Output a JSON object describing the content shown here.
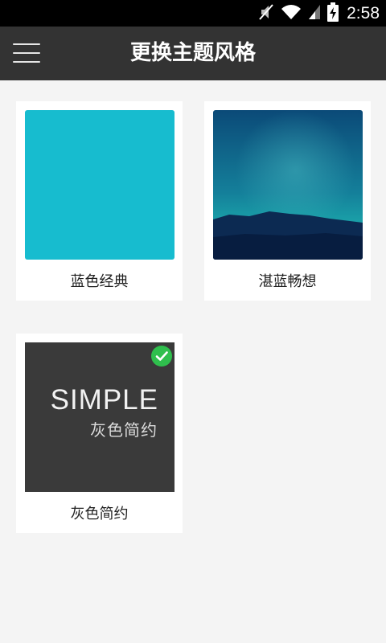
{
  "status_bar": {
    "time": "2:58",
    "icons": [
      "mute-icon",
      "wifi-icon",
      "signal-icon",
      "battery-charging-icon"
    ]
  },
  "app_bar": {
    "menu_icon": "hamburger-menu-icon",
    "title": "更换主题风格"
  },
  "themes": [
    {
      "label": "蓝色经典",
      "color": "#17bccf",
      "selected": false
    },
    {
      "label": "湛蓝畅想",
      "color": "#0e5a85",
      "selected": false
    },
    {
      "label": "灰色简约",
      "color": "#3a3a3a",
      "selected": true,
      "thumb_title": "SIMPLE",
      "thumb_subtitle": "灰色简约"
    }
  ],
  "colors": {
    "app_bar": "#333333",
    "background": "#f4f4f4",
    "selected_check": "#2fbf4d"
  }
}
